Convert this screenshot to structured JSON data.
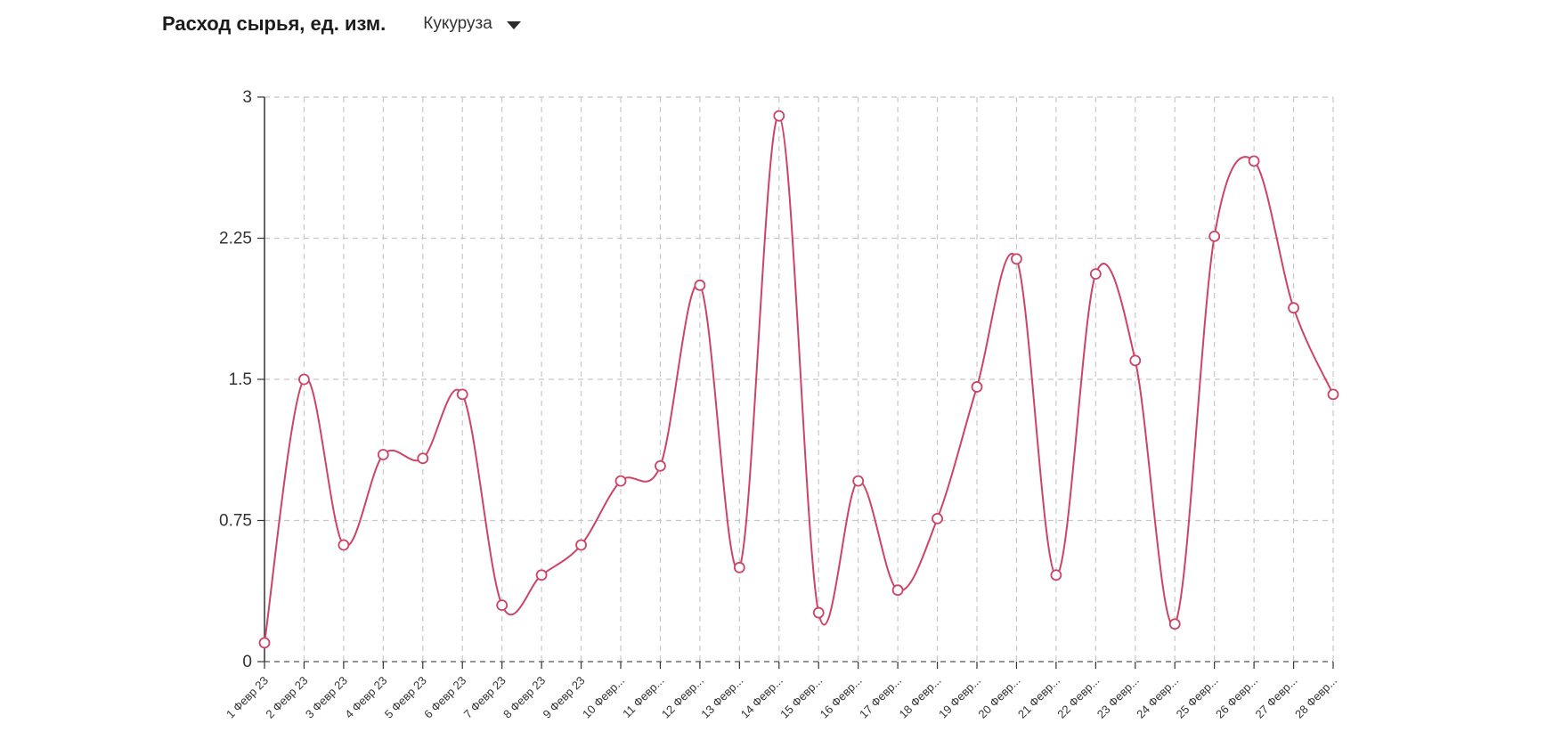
{
  "header": {
    "title": "Расход сырья, ед. изм.",
    "selector_value": "Кукуруза"
  },
  "icons": {
    "dropdown": "chevron-down-icon"
  },
  "colors": {
    "line": "#cc4466",
    "grid": "#c8c8c8",
    "axis": "#333333"
  },
  "chart_data": {
    "type": "line",
    "title": "Расход сырья, ед. изм.",
    "categories": [
      "1 Февр 23",
      "2 Февр 23",
      "3 Февр 23",
      "4 Февр 23",
      "5 Февр 23",
      "6 Февр 23",
      "7 Февр 23",
      "8 Февр 23",
      "9 Февр 23",
      "10 Февр...",
      "11 Февр...",
      "12 Февр...",
      "13 Февр...",
      "14 Февр...",
      "15 Февр...",
      "16 Февр...",
      "17 Февр...",
      "18 Февр...",
      "19 Февр...",
      "20 Февр...",
      "21 Февр...",
      "22 Февр...",
      "23 Февр...",
      "24 Февр...",
      "25 Февр...",
      "26 Февр...",
      "27 Февр...",
      "28 Февр..."
    ],
    "values": [
      0.1,
      1.5,
      0.62,
      1.1,
      1.08,
      1.42,
      0.3,
      0.46,
      0.62,
      0.96,
      1.04,
      2.0,
      0.5,
      2.9,
      0.26,
      0.96,
      0.38,
      0.76,
      1.46,
      2.14,
      0.46,
      2.06,
      1.6,
      0.2,
      2.26,
      2.66,
      1.88,
      1.42
    ],
    "yticks": [
      "0",
      "0.75",
      "1.5",
      "2.25",
      "3"
    ],
    "ylim": [
      0,
      3
    ],
    "grid": true,
    "xlabel": "",
    "ylabel": ""
  }
}
